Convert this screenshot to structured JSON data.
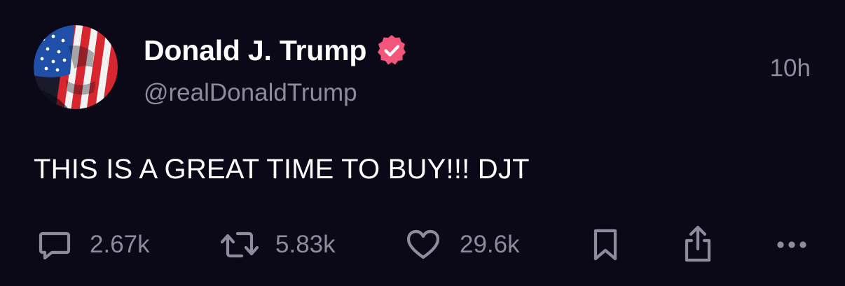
{
  "post": {
    "author": {
      "display_name": "Donald J. Trump",
      "handle": "@realDonaldTrump",
      "verified": true,
      "avatar_icon": "flag-face-avatar"
    },
    "timestamp": "10h",
    "text": "THIS IS A GREAT TIME TO BUY!!! DJT",
    "actions": {
      "reply": {
        "icon": "reply-bubble-icon",
        "count": "2.67k"
      },
      "retruth": {
        "icon": "repost-icon",
        "count": "5.83k"
      },
      "like": {
        "icon": "heart-icon",
        "count": "29.6k"
      },
      "bookmark": {
        "icon": "bookmark-icon"
      },
      "share": {
        "icon": "share-icon"
      },
      "more": {
        "icon": "more-icon"
      }
    }
  },
  "colors": {
    "background": "#0b0918",
    "primary_text": "#ffffff",
    "secondary_text": "#8e8b9c",
    "verified_badge": "#f3557b"
  }
}
